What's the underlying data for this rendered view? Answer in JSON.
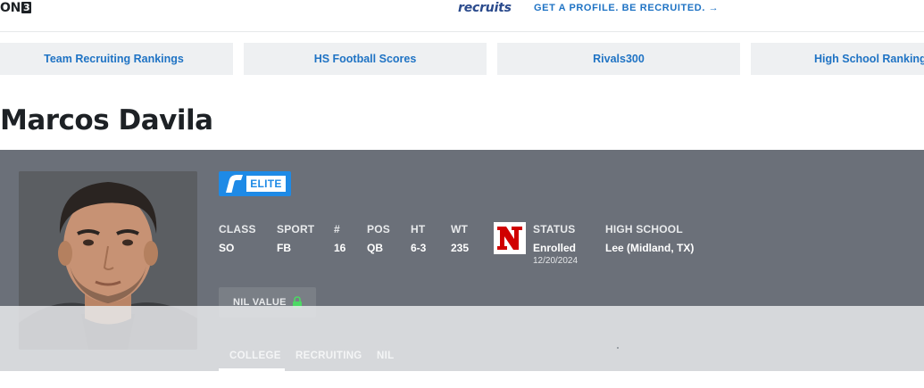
{
  "header": {
    "logo_text": "ON",
    "logo_badge": "3",
    "recruits_logo": "recruits",
    "cta": "GET A PROFILE. BE RECRUITED. →"
  },
  "nav_tiles": [
    {
      "label": "Team Recruiting Rankings"
    },
    {
      "label": "HS Football Scores"
    },
    {
      "label": "Rivals300"
    },
    {
      "label": "High School Rankings"
    }
  ],
  "player": {
    "name": "Marcos Davila",
    "badge": "ELITE",
    "stats": [
      {
        "label": "CLASS",
        "value": "SO"
      },
      {
        "label": "SPORT",
        "value": "FB"
      },
      {
        "label": "#",
        "value": "16"
      },
      {
        "label": "POS",
        "value": "QB"
      },
      {
        "label": "HT",
        "value": "6-3"
      },
      {
        "label": "WT",
        "value": "235"
      }
    ],
    "status": {
      "label": "STATUS",
      "value": "Enrolled",
      "date": "12/20/2024"
    },
    "high_school": {
      "label": "HIGH SCHOOL",
      "value": "Lee (Midland, TX)"
    },
    "team_logo_letter": "N",
    "nil_label": "NIL VALUE"
  },
  "tabs": [
    {
      "label": "COLLEGE",
      "active": true
    },
    {
      "label": "RECRUITING",
      "active": false
    },
    {
      "label": "NIL",
      "active": false
    }
  ],
  "colors": {
    "panel": "#6b7079",
    "accent_blue": "#1e8ae6",
    "link_blue": "#1f73c4",
    "team_red": "#d00000",
    "lock_green": "#4cd964"
  },
  "icons": {
    "rivals": "rivals-r-icon",
    "nil_lock": "lock-icon",
    "team": "nebraska-n-logo"
  }
}
